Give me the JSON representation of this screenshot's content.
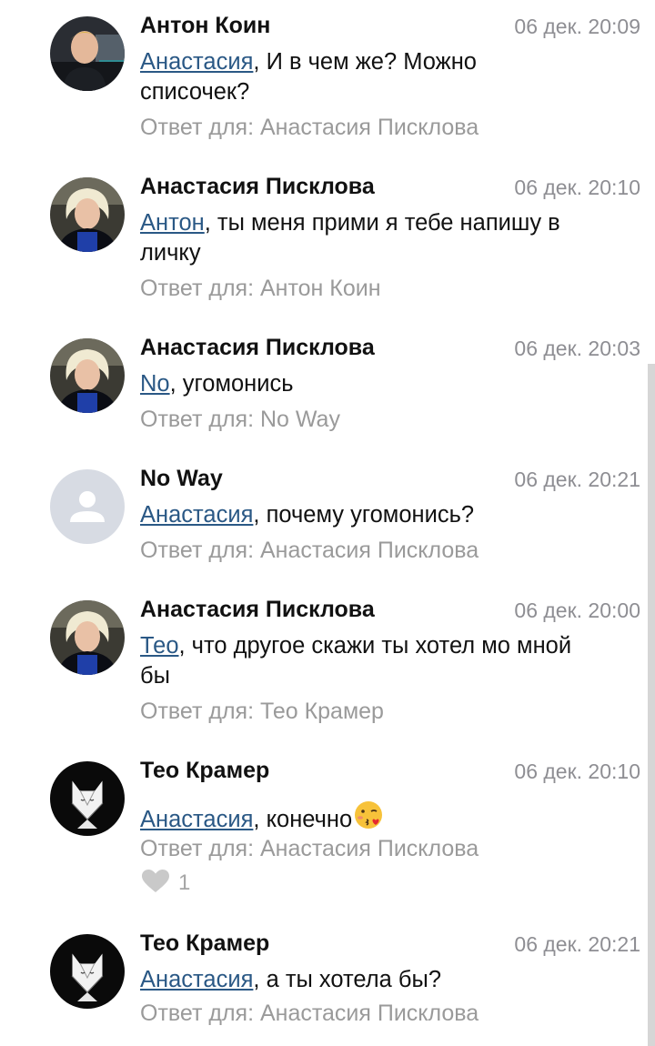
{
  "comments": [
    {
      "author": "Антон Коин",
      "date": "06 дек. 20:09",
      "mention": "Анастасия",
      "text_line1": ", И в чем же? Можно",
      "text_line2": "списочек?",
      "reply": "Ответ для: Анастасия Писклова"
    },
    {
      "author": "Анастасия Писклова",
      "date": "06 дек. 20:10",
      "mention": "Антон",
      "text_line1": ", ты меня прими я тебе напишу в",
      "text_line2": "личку",
      "reply": "Ответ для: Антон Коин"
    },
    {
      "author": "Анастасия Писклова",
      "date": "06 дек. 20:03",
      "mention": "No",
      "text_line1": ", угомонись",
      "reply": "Ответ для: No Way"
    },
    {
      "author": "No Way",
      "date": "06 дек. 20:21",
      "mention": "Анастасия",
      "text_line1": ", почему угомонись?",
      "reply": "Ответ для: Анастасия Писклова"
    },
    {
      "author": "Анастасия Писклова",
      "date": "06 дек. 20:00",
      "mention": "Тео",
      "text_line1": ", что другое скажи ты хотел мо мной",
      "text_line2": "бы",
      "reply": "Ответ для: Тео Крамер"
    },
    {
      "author": "Тео Крамер",
      "date": "06 дек. 20:10",
      "mention": "Анастасия",
      "text_line1": ", конечно",
      "emoji": "kissing-face-with-heart-emoji",
      "reply": "Ответ для: Анастасия Писклова",
      "likes": "1"
    },
    {
      "author": "Тео Крамер",
      "date": "06 дек. 20:21",
      "mention": "Анастасия",
      "text_line1": ", а ты хотела бы?",
      "reply": "Ответ для: Анастасия Писклова"
    }
  ],
  "icons": {
    "like": "heart-icon",
    "default_avatar": "user-silhouette-icon"
  },
  "colors": {
    "mention": "#2a5885",
    "meta_gray": "#9a9a9a",
    "default_avatar_bg": "#d7dbe3"
  }
}
